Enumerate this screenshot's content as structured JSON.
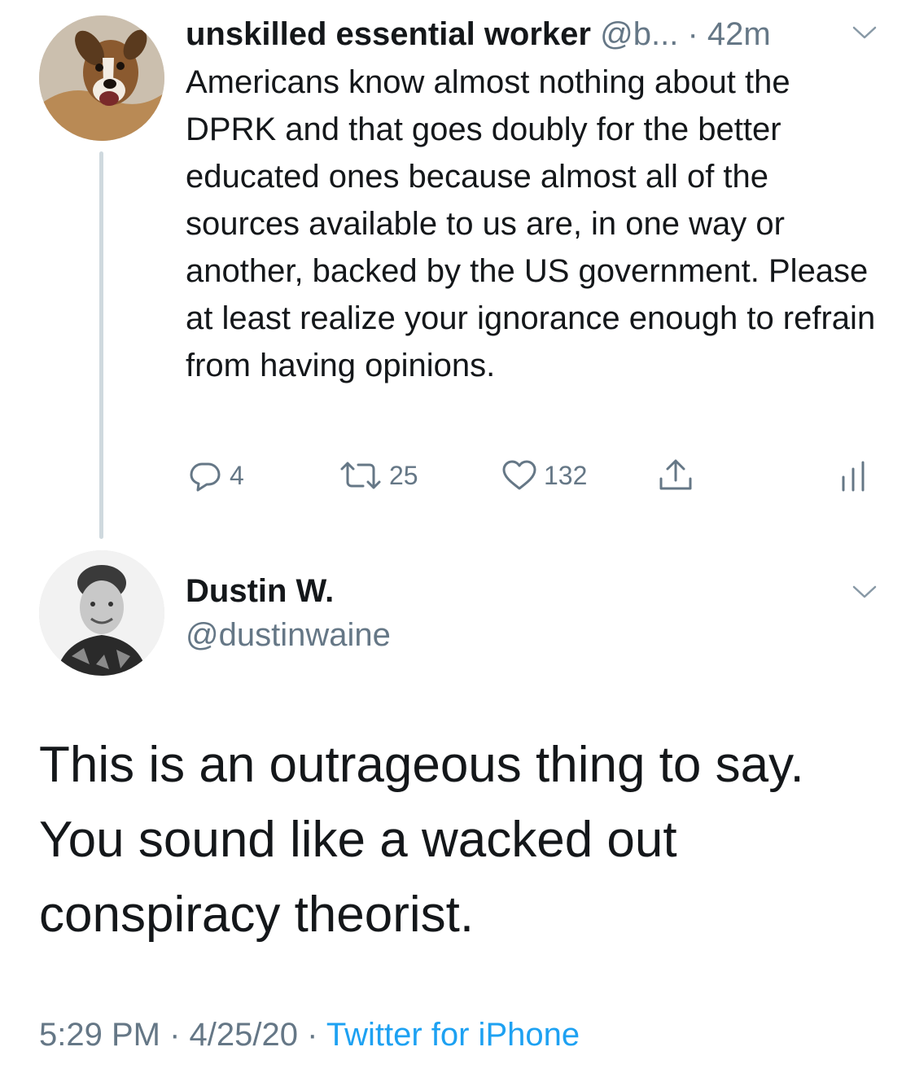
{
  "colors": {
    "text": "#14171a",
    "secondary": "#657786",
    "accent": "#1da1f2",
    "thread_line": "#cfd9de"
  },
  "tweet1": {
    "name": "unskilled essential worker",
    "handle": "@b...",
    "separator": "·",
    "time": "42m",
    "text": "Americans know almost nothing about the DPRK and that goes doubly for the better educated ones because almost all of the sources available to us are, in one way or another, backed by the US government. Please at least realize your ignorance enough to refrain from having opinions.",
    "actions": {
      "reply_count": "4",
      "retweet_count": "25",
      "like_count": "132"
    },
    "icons": [
      "reply-icon",
      "retweet-icon",
      "like-icon",
      "share-icon",
      "analytics-icon",
      "chevron-down-icon"
    ]
  },
  "tweet2": {
    "name": "Dustin W.",
    "handle": "@dustinwaine",
    "text": "This is an outrageous thing to say. You sound like a wacked out conspiracy theorist.",
    "time": "5:29 PM",
    "separator": "·",
    "date": "4/25/20",
    "source": "Twitter for iPhone"
  }
}
